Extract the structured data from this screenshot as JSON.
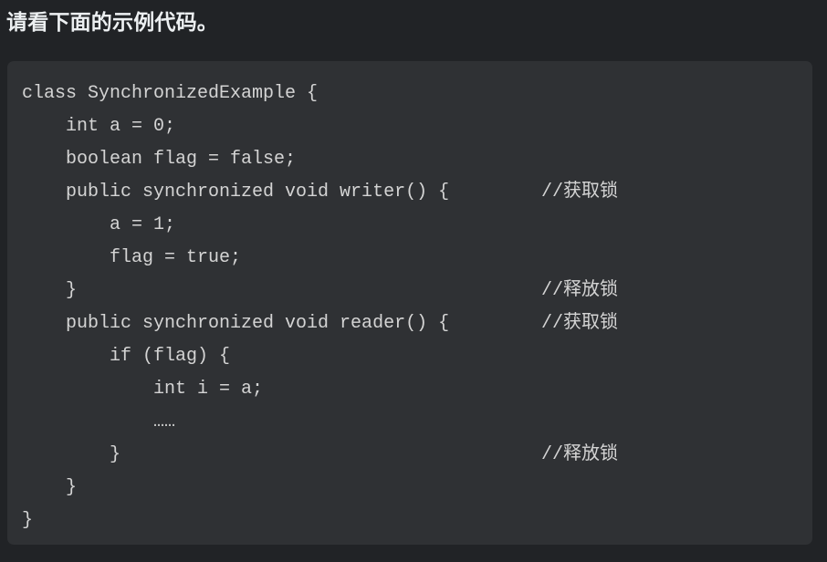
{
  "page": {
    "background_color": "#212326",
    "heading": "请看下面的示例代码。"
  },
  "code_block": {
    "background_color": "#2f3134",
    "text_color": "#d4d4d4",
    "language": "java",
    "lines": [
      {
        "code": "class SynchronizedExample {",
        "comment": ""
      },
      {
        "code": "    int a = 0;",
        "comment": ""
      },
      {
        "code": "    boolean flag = false;",
        "comment": ""
      },
      {
        "code": "    public synchronized void writer() {",
        "comment": "//获取锁"
      },
      {
        "code": "        a = 1;",
        "comment": ""
      },
      {
        "code": "        flag = true;",
        "comment": ""
      },
      {
        "code": "    }",
        "comment": "//释放锁"
      },
      {
        "code": "    public synchronized void reader() {",
        "comment": "//获取锁"
      },
      {
        "code": "        if (flag) {",
        "comment": ""
      },
      {
        "code": "            int i = a;",
        "comment": ""
      },
      {
        "code": "            ……",
        "comment": ""
      },
      {
        "code": "        }",
        "comment": "//释放锁"
      },
      {
        "code": "    }",
        "comment": ""
      },
      {
        "code": "}",
        "comment": ""
      }
    ]
  }
}
